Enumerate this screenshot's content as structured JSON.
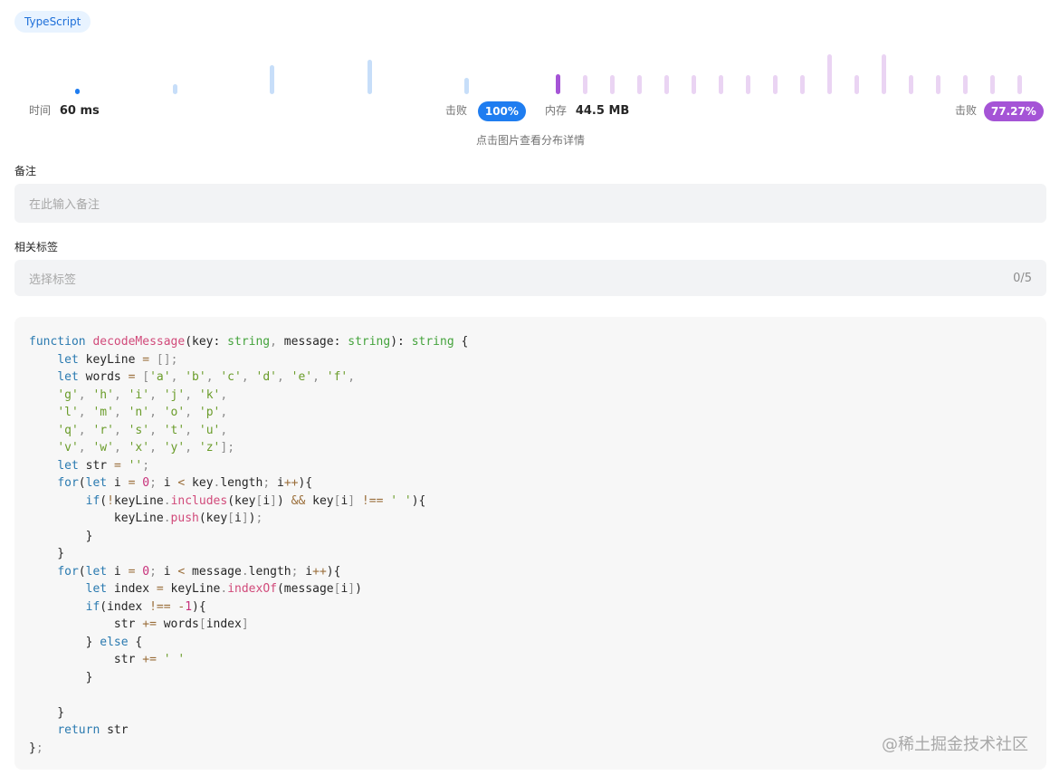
{
  "language_badge": "TypeScript",
  "runtime": {
    "label": "时间",
    "value": "60 ms",
    "beats_label": "击败",
    "beats_value": "100%",
    "color": "#1f7df0",
    "distribution_heights": [
      0.1,
      0.25,
      0.72,
      0.86,
      0.4
    ],
    "current_index": 0
  },
  "memory": {
    "label": "内存",
    "value": "44.5 MB",
    "beats_label": "击败",
    "beats_value": "77.27%",
    "color": "#a554d6",
    "distribution_heights": [
      0.5,
      0.48,
      0.48,
      0.48,
      0.48,
      0.48,
      0.48,
      0.48,
      0.48,
      0.48,
      1.0,
      0.48,
      1.0,
      0.48,
      0.48,
      0.48,
      0.48,
      0.48
    ],
    "current_index": 0
  },
  "hint_text": "点击图片查看分布详情",
  "notes": {
    "label": "备注",
    "placeholder": "在此输入备注"
  },
  "tags": {
    "label": "相关标签",
    "placeholder": "选择标签",
    "counter": "0/5"
  },
  "code_lines": [
    "function decodeMessage(key: string, message: string): string {",
    "    let keyLine = [];",
    "    let words = ['a', 'b', 'c', 'd', 'e', 'f',",
    "    'g', 'h', 'i', 'j', 'k',",
    "    'l', 'm', 'n', 'o', 'p',",
    "    'q', 'r', 's', 't', 'u',",
    "    'v', 'w', 'x', 'y', 'z'];",
    "    let str = '';",
    "    for(let i = 0; i < key.length; i++){",
    "        if(!keyLine.includes(key[i]) && key[i] !== ' '){",
    "            keyLine.push(key[i]);",
    "        }",
    "    }",
    "    for(let i = 0; i < message.length; i++){",
    "        let index = keyLine.indexOf(message[i])",
    "        if(index !== -1){",
    "            str += words[index]",
    "        } else {",
    "            str += ' '",
    "        }",
    "",
    "    }",
    "    return str",
    "};"
  ],
  "watermark": "@稀土掘金技术社区"
}
